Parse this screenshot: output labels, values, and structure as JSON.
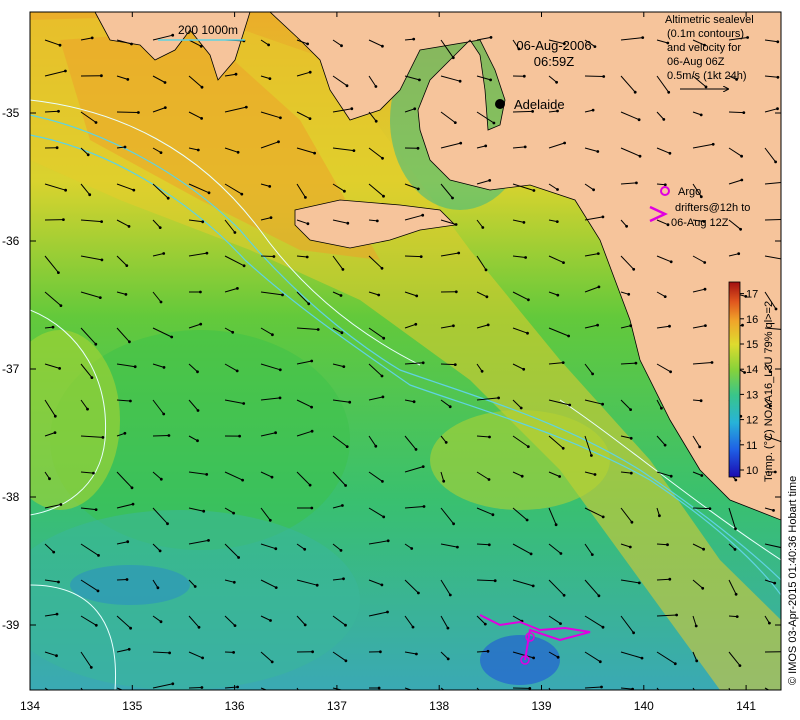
{
  "map": {
    "date": "06-Aug-2006",
    "time": "06:59Z",
    "depth_legend": "200  1000m",
    "city": "Adelaide",
    "sealevel_legend": [
      "Altimetric sealevel",
      "(0.1m contours)",
      "and velocity for",
      "06-Aug 06Z",
      "0.5m/s (1kt 24h)"
    ],
    "argo_legend": [
      "Argo",
      "drifters@12h to",
      "06-Aug 12Z"
    ],
    "x_ticks": [
      "134",
      "135",
      "136",
      "137",
      "138",
      "139",
      "140",
      "141"
    ],
    "y_ticks": [
      "-35",
      "-36",
      "-37",
      "-38",
      "-39"
    ],
    "colorbar": {
      "title": "Temp. (°C) NOAA16_L3U 79% ql>=2",
      "ticks": [
        "10",
        "11",
        "12",
        "13",
        "14",
        "15",
        "16",
        "17"
      ]
    },
    "credit": "© IMOS 03-Apr-2015 01:40:36 Hobart time"
  }
}
